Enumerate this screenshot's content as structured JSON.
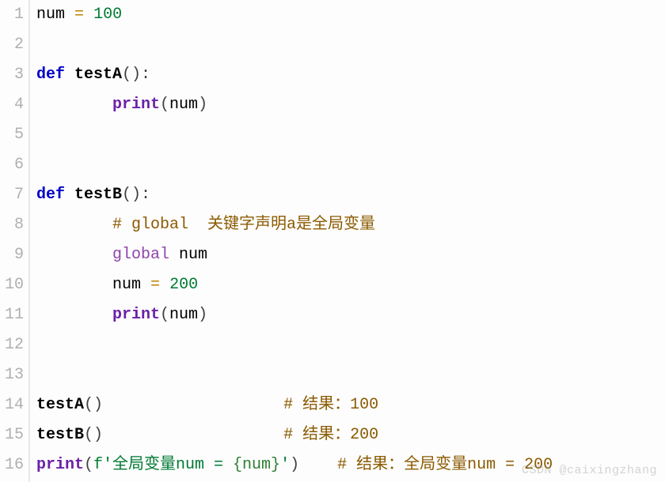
{
  "line_numbers": [
    "1",
    "2",
    "3",
    "4",
    "5",
    "6",
    "7",
    "8",
    "9",
    "10",
    "11",
    "12",
    "13",
    "14",
    "15",
    "16"
  ],
  "lines": {
    "l1": {
      "a": "num",
      "b": " ",
      "c": "=",
      "d": " ",
      "e": "100"
    },
    "l2": {},
    "l3": {
      "a": "def",
      "b": " ",
      "c": "testA",
      "d": "():"
    },
    "l4": {
      "indent": "        ",
      "a": "print",
      "b": "(",
      "c": "num",
      "d": ")"
    },
    "l5": {},
    "l6": {},
    "l7": {
      "a": "def",
      "b": " ",
      "c": "testB",
      "d": "():"
    },
    "l8": {
      "indent": "        ",
      "a": "# global  关键字声明a是全局变量"
    },
    "l9": {
      "indent": "        ",
      "a": "global",
      "b": " ",
      "c": "num"
    },
    "l10": {
      "indent": "        ",
      "a": "num",
      "b": " ",
      "c": "=",
      "d": " ",
      "e": "200"
    },
    "l11": {
      "indent": "        ",
      "a": "print",
      "b": "(",
      "c": "num",
      "d": ")"
    },
    "l12": {},
    "l13": {},
    "l14": {
      "a": "testA",
      "b": "()",
      "pad": "                   ",
      "c": "# 结果：100"
    },
    "l15": {
      "a": "testB",
      "b": "()",
      "pad": "                   ",
      "c": "# 结果：200"
    },
    "l16": {
      "a": "print",
      "b": "(",
      "c": "f'全局变量num = ",
      "d": "{num}",
      "e": "'",
      "f": ")",
      "pad": "    ",
      "g": "# 结果：全局变量num = 200"
    }
  },
  "watermark": "CSDN @caixingzhang"
}
